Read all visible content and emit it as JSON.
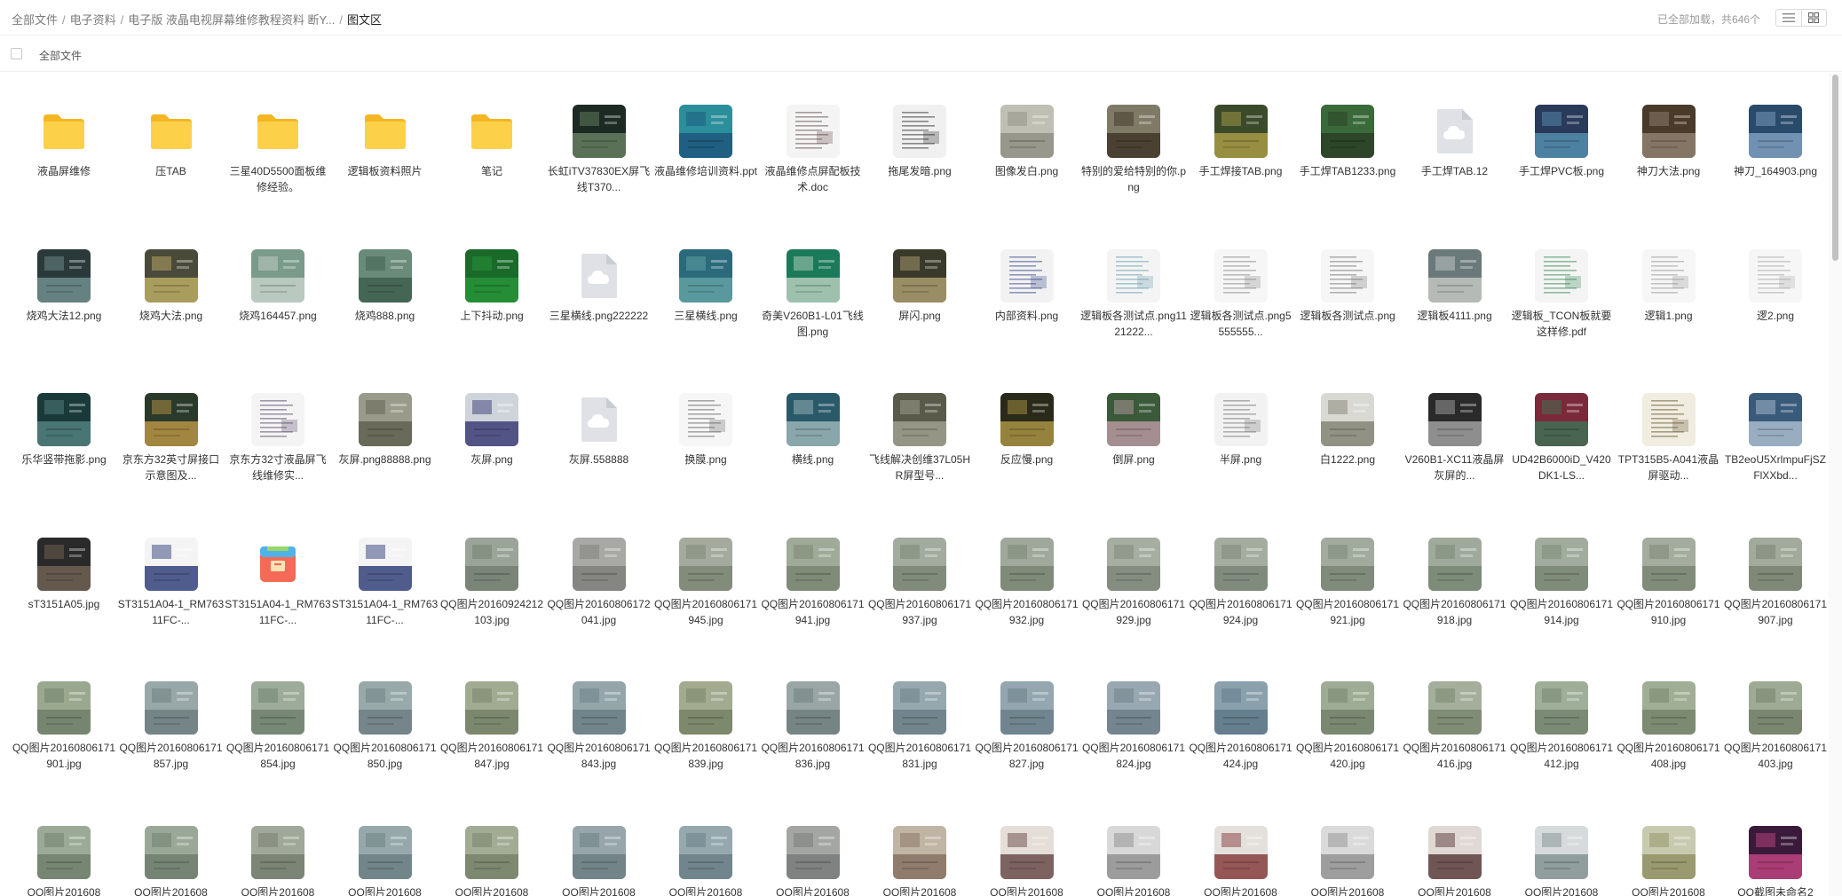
{
  "breadcrumb": [
    {
      "label": "全部文件"
    },
    {
      "label": "电子资料"
    },
    {
      "label": "电子版 液晶电视屏幕维修教程资料 断Y..."
    },
    {
      "label": "图文区",
      "current": true
    }
  ],
  "status": "已全部加载，共646个",
  "select_all_label": "全部文件",
  "rows": [
    [
      {
        "name": "液晶屏维修",
        "type": "folder"
      },
      {
        "name": "压TAB",
        "type": "folder"
      },
      {
        "name": "三星40D5500面板维修经验。",
        "type": "folder"
      },
      {
        "name": "逻辑板资料照片",
        "type": "folder"
      },
      {
        "name": "笔记",
        "type": "folder"
      },
      {
        "name": "长虹iTV37830EX屏飞线T370...",
        "type": "image",
        "colors": [
          "#1d2a24",
          "#6f8a6a"
        ]
      },
      {
        "name": "液晶维修培训资料.ppt",
        "type": "image",
        "colors": [
          "#2a8f9a",
          "#1d4f7a"
        ]
      },
      {
        "name": "液晶维修点屏配板技术.doc",
        "type": "doc",
        "colors": [
          "#f4f4f4",
          "#6a5050"
        ]
      },
      {
        "name": "拖尾发暗.png",
        "type": "doc",
        "colors": [
          "#f0f0f0",
          "#333333"
        ]
      },
      {
        "name": "图像发白.png",
        "type": "image",
        "colors": [
          "#bfbfb3",
          "#8a8a7e"
        ]
      },
      {
        "name": "特别的爱给特别的你.png",
        "type": "image",
        "colors": [
          "#7f7a66",
          "#3a2f22"
        ]
      },
      {
        "name": "手工焊接TAB.png",
        "type": "image",
        "colors": [
          "#3a4a2a",
          "#b7a64a"
        ]
      },
      {
        "name": "手工焊TAB1233.png",
        "type": "image",
        "colors": [
          "#3a6a3a",
          "#2a3a24"
        ]
      },
      {
        "name": "手工焊TAB.12",
        "type": "cloud"
      },
      {
        "name": "手工焊PVC板.png",
        "type": "image",
        "colors": [
          "#2a3a5a",
          "#5a9aba"
        ]
      },
      {
        "name": "神刀大法.png",
        "type": "image",
        "colors": [
          "#4a3a2a",
          "#9a8a7a"
        ]
      },
      {
        "name": "神刀_164903.png",
        "type": "image",
        "colors": [
          "#2a4a6a",
          "#8aaacb"
        ]
      }
    ],
    [
      {
        "name": "烧鸡大法12.png",
        "type": "image",
        "colors": [
          "#2a3a3a",
          "#7a9a9a"
        ]
      },
      {
        "name": "烧鸡大法.png",
        "type": "image",
        "colors": [
          "#4a4a3a",
          "#c9b96a"
        ]
      },
      {
        "name": "烧鸡164457.png",
        "type": "image",
        "colors": [
          "#7a9a8a",
          "#cfd8d0"
        ]
      },
      {
        "name": "烧鸡888.png",
        "type": "image",
        "colors": [
          "#6a8a7a",
          "#3a5a4a"
        ]
      },
      {
        "name": "上下抖动.png",
        "type": "image",
        "colors": [
          "#1a6a2a",
          "#2a9a3a"
        ]
      },
      {
        "name": "三星横线.png222222",
        "type": "cloud"
      },
      {
        "name": "三星横线.png",
        "type": "image",
        "colors": [
          "#2a6a7a",
          "#6aaaaa"
        ]
      },
      {
        "name": "奇美V260B1-L01飞线图.png",
        "type": "image",
        "colors": [
          "#1a7a5a",
          "#c9d9c9"
        ]
      },
      {
        "name": "屏闪.png",
        "type": "image",
        "colors": [
          "#3a3a2a",
          "#b9a97a"
        ]
      },
      {
        "name": "内部资料.png",
        "type": "doc",
        "colors": [
          "#f2f2f2",
          "#3a4a8a"
        ]
      },
      {
        "name": "逻辑板各测试点.png1121222...",
        "type": "doc",
        "colors": [
          "#f4f4f4",
          "#6aa0b0"
        ]
      },
      {
        "name": "逻辑板各测试点.png5555555...",
        "type": "doc",
        "colors": [
          "#f6f6f6",
          "#888888"
        ]
      },
      {
        "name": "逻辑板各测试点.png",
        "type": "doc",
        "colors": [
          "#f6f6f6",
          "#777777"
        ]
      },
      {
        "name": "逻辑板4111.png",
        "type": "image",
        "colors": [
          "#6a7a7a",
          "#cfd0cc"
        ]
      },
      {
        "name": "逻辑板_TCON板就要这样修.pdf",
        "type": "doc",
        "colors": [
          "#f4f4f4",
          "#3a8a5a"
        ]
      },
      {
        "name": "逻辑1.png",
        "type": "doc",
        "colors": [
          "#f6f6f6",
          "#999999"
        ]
      },
      {
        "name": "逻2.png",
        "type": "doc",
        "colors": [
          "#f6f6f6",
          "#aaaaaa"
        ]
      }
    ],
    [
      {
        "name": "乐华竖带拖影.png",
        "type": "image",
        "colors": [
          "#1a3a3a",
          "#5a8a8a"
        ]
      },
      {
        "name": "京东方32英寸屏接口示意图及...",
        "type": "image",
        "colors": [
          "#2a3a2a",
          "#caa04a"
        ]
      },
      {
        "name": "京东方32寸液晶屏飞线维修实...",
        "type": "doc",
        "colors": [
          "#f4f4f4",
          "#5a4a6a"
        ]
      },
      {
        "name": "灰屏.png88888.png",
        "type": "image",
        "colors": [
          "#9a9a8a",
          "#5a5a4a"
        ]
      },
      {
        "name": "灰屏.png",
        "type": "image",
        "colors": [
          "#cfd4da",
          "#2a2a6a"
        ]
      },
      {
        "name": "灰屏.558888",
        "type": "cloud"
      },
      {
        "name": "换膜.png",
        "type": "doc",
        "colors": [
          "#f6f6f6",
          "#666666"
        ]
      },
      {
        "name": "横线.png",
        "type": "image",
        "colors": [
          "#2a5a6a",
          "#a9c0c0"
        ]
      },
      {
        "name": "飞线解决创维37L05HR屏型号...",
        "type": "image",
        "colors": [
          "#5a5a4a",
          "#a9a99a"
        ]
      },
      {
        "name": "反应慢.png",
        "type": "image",
        "colors": [
          "#2a2a1a",
          "#b9a04a"
        ]
      },
      {
        "name": "倒屏.png",
        "type": "image",
        "colors": [
          "#3a5a3a",
          "#c9a0b0"
        ]
      },
      {
        "name": "半屏.png",
        "type": "doc",
        "colors": [
          "#f2f2f2",
          "#777777"
        ]
      },
      {
        "name": "白1222.png",
        "type": "image",
        "colors": [
          "#d9d9d4",
          "#7a7a6a"
        ]
      },
      {
        "name": "V260B1-XC11液晶屏灰屏的...",
        "type": "image",
        "colors": [
          "#2a2a2a",
          "#b0b0b0"
        ]
      },
      {
        "name": "UD42B6000iD_V420DK1-LS...",
        "type": "image",
        "colors": [
          "#7a2a3a",
          "#3a7a5a"
        ]
      },
      {
        "name": "TPT315B5-A041液晶屏驱动...",
        "type": "doc",
        "colors": [
          "#f0ede0",
          "#6a5a3a"
        ]
      },
      {
        "name": "TB2eoU5XrlmpuFjSZFlXXbd...",
        "type": "image",
        "colors": [
          "#3a5a7a",
          "#b9c9d9"
        ]
      }
    ],
    [
      {
        "name": "sT3151A05.jpg",
        "type": "image",
        "colors": [
          "#2a2a2a",
          "#7a6a5a"
        ]
      },
      {
        "name": "ST3151A04-1_RM76311FC-...",
        "type": "image",
        "colors": [
          "#f4f4f4",
          "#1a2a6a"
        ]
      },
      {
        "name": "ST3151A04-1_RM76311FC-...",
        "type": "package"
      },
      {
        "name": "ST3151A04-1_RM76311FC-...",
        "type": "image",
        "colors": [
          "#f4f4f4",
          "#1a2a6a"
        ]
      },
      {
        "name": "QQ图片20160924212103.jpg",
        "type": "image",
        "colors": [
          "#9aa498",
          "#6f7a6c"
        ]
      },
      {
        "name": "QQ图片20160806172041.jpg",
        "type": "image",
        "colors": [
          "#a8a8a4",
          "#7a7a76"
        ]
      },
      {
        "name": "QQ图片20160806171945.jpg",
        "type": "image",
        "colors": [
          "#a4ab9e",
          "#78806f"
        ]
      },
      {
        "name": "QQ图片20160806171941.jpg",
        "type": "image",
        "colors": [
          "#a0aa98",
          "#76806c"
        ]
      },
      {
        "name": "QQ图片20160806171937.jpg",
        "type": "image",
        "colors": [
          "#a2ab9e",
          "#76806f"
        ]
      },
      {
        "name": "QQ图片20160806171932.jpg",
        "type": "image",
        "colors": [
          "#a0a89c",
          "#74806e"
        ]
      },
      {
        "name": "QQ图片20160806171929.jpg",
        "type": "image",
        "colors": [
          "#a6aea2",
          "#7a8274"
        ]
      },
      {
        "name": "QQ图片20160806171924.jpg",
        "type": "image",
        "colors": [
          "#a4aca0",
          "#768072"
        ]
      },
      {
        "name": "QQ图片20160806171921.jpg",
        "type": "image",
        "colors": [
          "#a2aa9e",
          "#748070"
        ]
      },
      {
        "name": "QQ图片20160806171918.jpg",
        "type": "image",
        "colors": [
          "#a0aa9c",
          "#72806e"
        ]
      },
      {
        "name": "QQ图片20160806171914.jpg",
        "type": "image",
        "colors": [
          "#a2ac9e",
          "#74826e"
        ]
      },
      {
        "name": "QQ图片20160806171910.jpg",
        "type": "image",
        "colors": [
          "#a4ac9e",
          "#76806e"
        ]
      },
      {
        "name": "QQ图片20160806171907.jpg",
        "type": "image",
        "colors": [
          "#a2aa9c",
          "#747e6c"
        ]
      }
    ],
    [
      {
        "name": "QQ图片20160806171901.jpg",
        "type": "image",
        "colors": [
          "#9aa890",
          "#6a7a64"
        ]
      },
      {
        "name": "QQ图片20160806171857.jpg",
        "type": "image",
        "colors": [
          "#98a8a8",
          "#6a7a7c"
        ]
      },
      {
        "name": "QQ图片20160806171854.jpg",
        "type": "image",
        "colors": [
          "#9cab9a",
          "#6c7c6a"
        ]
      },
      {
        "name": "QQ图片20160806171850.jpg",
        "type": "image",
        "colors": [
          "#98a9aa",
          "#6a7a7e"
        ]
      },
      {
        "name": "QQ图片20160806171847.jpg",
        "type": "image",
        "colors": [
          "#a0ab92",
          "#707c62"
        ]
      },
      {
        "name": "QQ图片20160806171843.jpg",
        "type": "image",
        "colors": [
          "#94a6aa",
          "#667a80"
        ]
      },
      {
        "name": "QQ图片20160806171839.jpg",
        "type": "image",
        "colors": [
          "#a2ab90",
          "#727c60"
        ]
      },
      {
        "name": "QQ图片20160806171836.jpg",
        "type": "image",
        "colors": [
          "#9aa6a6",
          "#6a7878"
        ]
      },
      {
        "name": "QQ图片20160806171831.jpg",
        "type": "image",
        "colors": [
          "#96a8ae",
          "#667a82"
        ]
      },
      {
        "name": "QQ图片20160806171827.jpg",
        "type": "image",
        "colors": [
          "#94a6b0",
          "#647a84"
        ]
      },
      {
        "name": "QQ图片20160806171824.jpg",
        "type": "image",
        "colors": [
          "#98a8b0",
          "#687a84"
        ]
      },
      {
        "name": "QQ图片20160806171424.jpg",
        "type": "image",
        "colors": [
          "#8aa0ac",
          "#5a7484"
        ]
      },
      {
        "name": "QQ图片20160806171420.jpg",
        "type": "image",
        "colors": [
          "#9eac96",
          "#6e7c66"
        ]
      },
      {
        "name": "QQ图片20160806171416.jpg",
        "type": "image",
        "colors": [
          "#a4ae9a",
          "#74806a"
        ]
      },
      {
        "name": "QQ图片20160806171412.jpg",
        "type": "image",
        "colors": [
          "#9eae98",
          "#6e7e68"
        ]
      },
      {
        "name": "QQ图片20160806171408.jpg",
        "type": "image",
        "colors": [
          "#a0ae96",
          "#707e66"
        ]
      },
      {
        "name": "QQ图片20160806171403.jpg",
        "type": "image",
        "colors": [
          "#9eaa94",
          "#6e7a64"
        ]
      }
    ],
    [
      {
        "name": "QQ图片201608",
        "type": "image",
        "colors": [
          "#9aaa96",
          "#6a7a66"
        ]
      },
      {
        "name": "QQ图片201608",
        "type": "image",
        "colors": [
          "#9aa898",
          "#6a786a"
        ]
      },
      {
        "name": "QQ图片201608",
        "type": "image",
        "colors": [
          "#a0a89a",
          "#70786a"
        ]
      },
      {
        "name": "QQ图片201608",
        "type": "image",
        "colors": [
          "#96a8aa",
          "#667a7c"
        ]
      },
      {
        "name": "QQ图片201608",
        "type": "image",
        "colors": [
          "#a2ab94",
          "#727c64"
        ]
      },
      {
        "name": "QQ图片201608",
        "type": "image",
        "colors": [
          "#96a6aa",
          "#66787c"
        ]
      },
      {
        "name": "QQ图片201608",
        "type": "image",
        "colors": [
          "#94a8ae",
          "#647a80"
        ]
      },
      {
        "name": "QQ图片201608",
        "type": "image",
        "colors": [
          "#a4a6a4",
          "#747676"
        ]
      },
      {
        "name": "QQ图片201608",
        "type": "image",
        "colors": [
          "#c0b4a4",
          "#806a5a"
        ]
      },
      {
        "name": "QQ图片201608",
        "type": "image",
        "colors": [
          "#e4ddd8",
          "#5a3a3a"
        ]
      },
      {
        "name": "QQ图片201608",
        "type": "image",
        "colors": [
          "#d8d8d8",
          "#888888"
        ]
      },
      {
        "name": "QQ图片201608",
        "type": "image",
        "colors": [
          "#e4e0dc",
          "#7a2a2a"
        ]
      },
      {
        "name": "QQ图片201608",
        "type": "image",
        "colors": [
          "#dadada",
          "#8a8a8a"
        ]
      },
      {
        "name": "QQ图片201608",
        "type": "image",
        "colors": [
          "#e0d8d4",
          "#4a2a2a"
        ]
      },
      {
        "name": "QQ图片201608",
        "type": "image",
        "colors": [
          "#d6dada",
          "#7a8a8a"
        ]
      },
      {
        "name": "QQ图片201608",
        "type": "image",
        "colors": [
          "#c8cab0",
          "#8a8a5a"
        ]
      },
      {
        "name": "QQ截图未命名2",
        "type": "image",
        "colors": [
          "#3a1a3a",
          "#d04a8a"
        ]
      }
    ]
  ]
}
